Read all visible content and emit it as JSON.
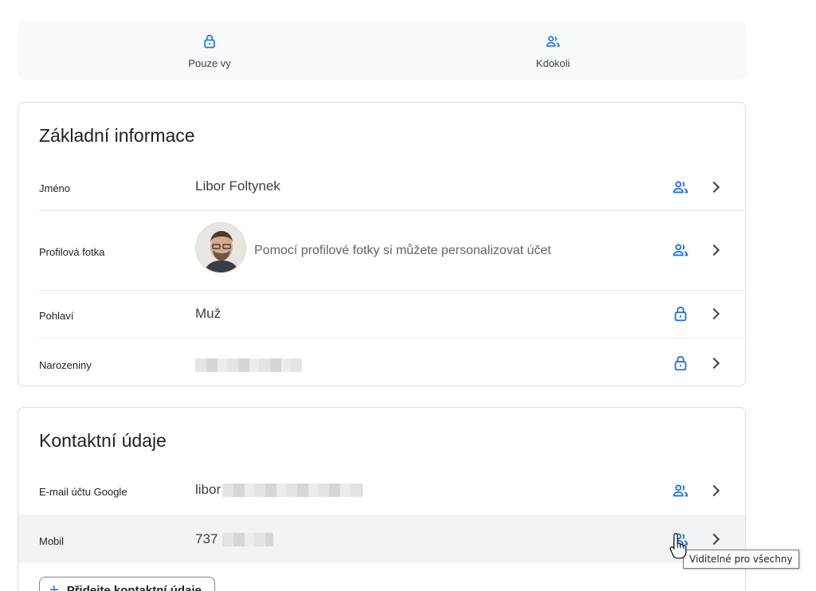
{
  "colors": {
    "accent": "#1a73e8",
    "text": "#202124",
    "muted": "#5f6368",
    "border": "#dadce0"
  },
  "legend": [
    {
      "label": "Pouze vy",
      "icon": "lock-icon"
    },
    {
      "label": "Kdokoli",
      "icon": "people-icon"
    }
  ],
  "basic_info": {
    "title": "Základní informace",
    "rows": [
      {
        "label": "Jméno",
        "value": "Libor Foltynek",
        "visibility": "people-icon"
      },
      {
        "label": "Profilová fotka",
        "value": "Pomocí profilové fotky si můžete personalizovat účet",
        "visibility": "people-icon"
      },
      {
        "label": "Pohlaví",
        "value": "Muž",
        "visibility": "lock-icon"
      },
      {
        "label": "Narozeniny",
        "value": "",
        "visibility": "lock-icon"
      }
    ]
  },
  "contact_info": {
    "title": "Kontaktní údaje",
    "rows": [
      {
        "label": "E-mail účtu Google",
        "value": "libor",
        "visibility": "people-icon"
      },
      {
        "label": "Mobil",
        "value": "737",
        "visibility": "people-icon"
      }
    ],
    "add_button": "Přidejte kontaktní údaje"
  },
  "tooltip": "Viditelné pro všechny"
}
